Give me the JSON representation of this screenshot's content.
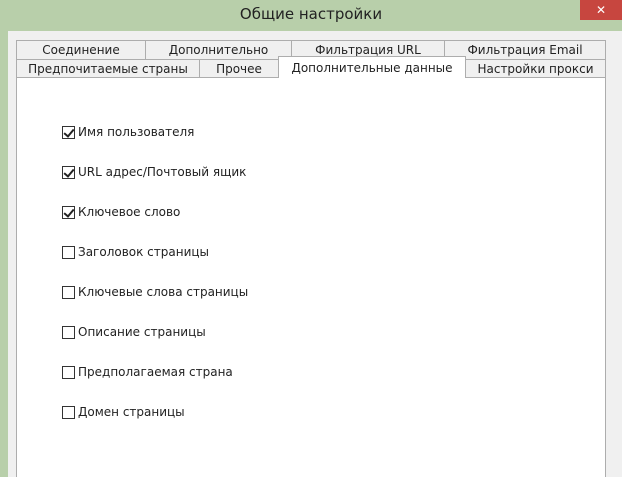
{
  "window": {
    "title": "Общие настройки",
    "close_glyph": "✕"
  },
  "tabs": {
    "row_back": [
      {
        "label": "Соединение"
      },
      {
        "label": "Дополнительно"
      },
      {
        "label": "Фильтрация URL"
      },
      {
        "label": "Фильтрация Email"
      }
    ],
    "row_front": [
      {
        "label": "Предпочитаемые страны"
      },
      {
        "label": "Прочее"
      },
      {
        "label": "Дополнительные данные",
        "selected": true
      },
      {
        "label": "Настройки прокси"
      }
    ]
  },
  "options": [
    {
      "label": "Имя пользователя",
      "checked": true
    },
    {
      "label": "URL адрес/Почтовый ящик",
      "checked": true
    },
    {
      "label": "Ключевое слово",
      "checked": true
    },
    {
      "label": "Заголовок страницы",
      "checked": false
    },
    {
      "label": "Ключевые слова страницы",
      "checked": false
    },
    {
      "label": "Описание страницы",
      "checked": false
    },
    {
      "label": "Предполагаемая страна",
      "checked": false
    },
    {
      "label": "Домен страницы",
      "checked": false
    }
  ]
}
